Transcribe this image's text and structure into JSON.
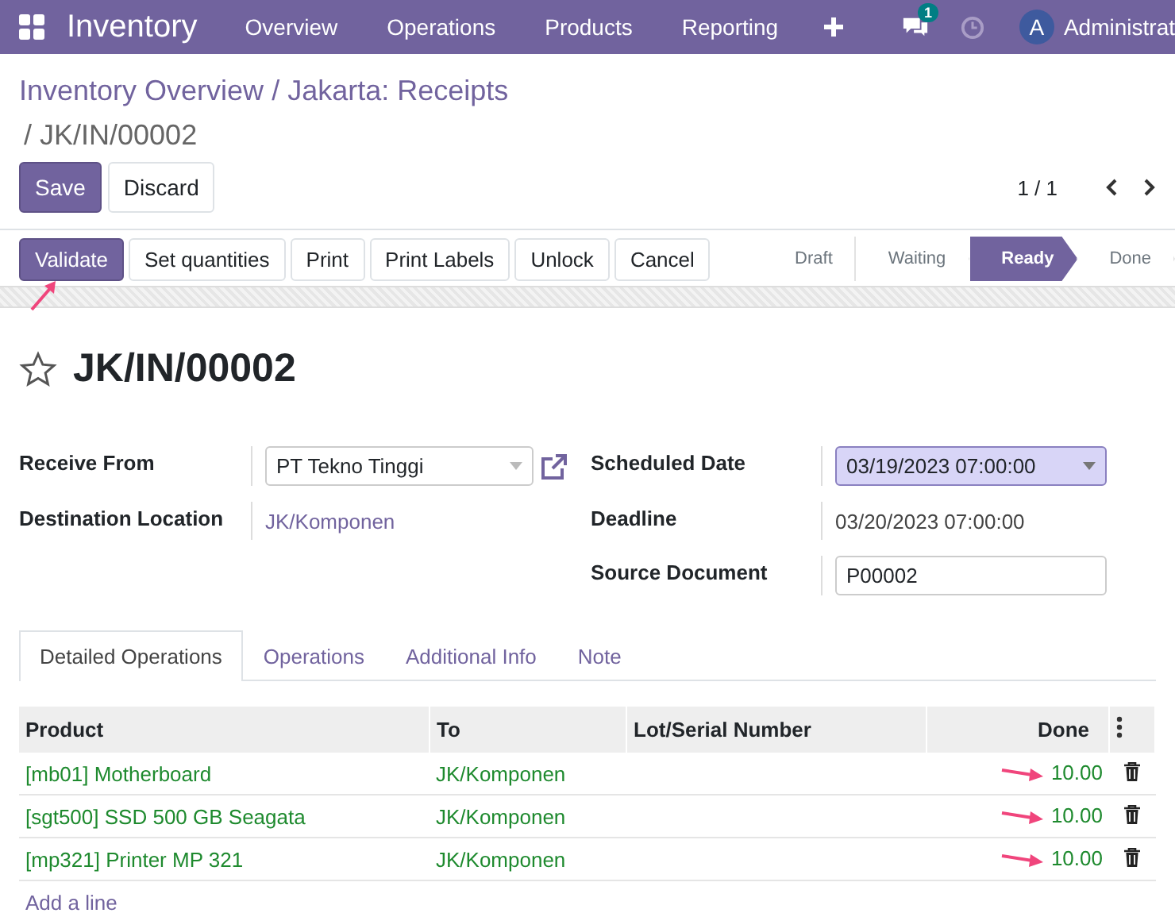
{
  "navbar": {
    "app_name": "Inventory",
    "menu": [
      "Overview",
      "Operations",
      "Products",
      "Reporting"
    ],
    "message_count": "1",
    "avatar_letter": "A",
    "user": "Administrat"
  },
  "breadcrumb": {
    "links": [
      "Inventory Overview",
      "Jakarta: Receipts"
    ],
    "separator": "/",
    "current": "JK/IN/00002"
  },
  "form_buttons": [
    {
      "label": "Save",
      "kind": "primary"
    },
    {
      "label": "Discard",
      "kind": "secondary"
    }
  ],
  "pager": "1 / 1",
  "actions": [
    {
      "label": "Validate",
      "kind": "primary",
      "arrow": true
    },
    {
      "label": "Set quantities",
      "kind": "secondary",
      "arrow": false
    },
    {
      "label": "Print",
      "kind": "secondary",
      "arrow": false
    },
    {
      "label": "Print Labels",
      "kind": "secondary",
      "arrow": false
    },
    {
      "label": "Unlock",
      "kind": "secondary",
      "arrow": false
    },
    {
      "label": "Cancel",
      "kind": "secondary",
      "arrow": false
    }
  ],
  "stages": [
    {
      "label": "Draft",
      "selected": false
    },
    {
      "label": "Waiting",
      "selected": false
    },
    {
      "label": "Ready",
      "selected": true
    },
    {
      "label": "Done",
      "selected": false
    }
  ],
  "title": "JK/IN/00002",
  "starred": false,
  "left_fields": [
    {
      "label": "Receive From",
      "kind": "select",
      "value": "PT Tekno Tinggi",
      "external": true
    },
    {
      "label": "Destination Location",
      "kind": "link",
      "value": "JK/Komponen"
    }
  ],
  "right_fields": [
    {
      "label": "Scheduled Date",
      "kind": "select",
      "value": "03/19/2023 07:00:00",
      "focused": true
    },
    {
      "label": "Deadline",
      "kind": "text",
      "value": "03/20/2023 07:00:00"
    },
    {
      "label": "Source Document",
      "kind": "input",
      "value": "P00002"
    }
  ],
  "tabs": [
    {
      "label": "Detailed Operations",
      "selected": true
    },
    {
      "label": "Operations",
      "selected": false
    },
    {
      "label": "Additional Info",
      "selected": false
    },
    {
      "label": "Note",
      "selected": false
    }
  ],
  "table": {
    "columns": [
      "Product",
      "To",
      "Lot/Serial Number",
      "Done"
    ],
    "rows": [
      {
        "product": "[mb01] Motherboard",
        "to": "JK/Komponen",
        "done": "10.00",
        "arrow": true
      },
      {
        "product": "[sgt500] SSD 500 GB Seagata",
        "to": "JK/Komponen",
        "done": "10.00",
        "arrow": true
      },
      {
        "product": "[mp321] Printer MP 321",
        "to": "JK/Komponen",
        "done": "10.00",
        "arrow": true
      }
    ],
    "add_line": "Add a line"
  }
}
